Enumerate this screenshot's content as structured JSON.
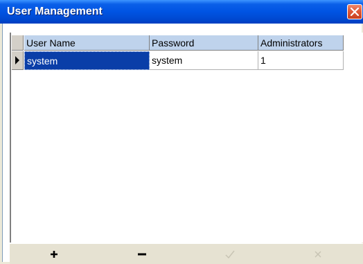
{
  "window": {
    "title": "User Management"
  },
  "grid": {
    "columns": [
      "User Name",
      "Password",
      "Administrators"
    ],
    "rows": [
      {
        "user_name": "system",
        "password": "system",
        "administrators": "1",
        "current": true
      }
    ]
  },
  "toolbar": {
    "buttons": [
      {
        "icon": "plus-icon",
        "enabled": true
      },
      {
        "icon": "minus-icon",
        "enabled": true
      },
      {
        "icon": "check-icon",
        "enabled": false
      },
      {
        "icon": "cancel-icon",
        "enabled": false
      }
    ]
  },
  "colors": {
    "title_bar": "#0054e3",
    "selection": "#0a3ea8",
    "header": "#bfd3ec",
    "close_button": "#e05a38"
  }
}
